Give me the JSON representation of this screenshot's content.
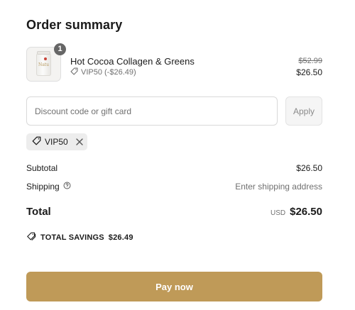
{
  "summary": {
    "title": "Order summary"
  },
  "product": {
    "quantity": "1",
    "name": "Hot Cocoa Collagen & Greens",
    "discount_label": "VIP50 (-$26.49)",
    "original_price": "$52.99",
    "price": "$26.50",
    "thumbnail_icon": "product-jar-icon"
  },
  "discount": {
    "placeholder": "Discount code or gift card",
    "value": "",
    "apply_label": "Apply",
    "applied_code": "VIP50"
  },
  "totals": {
    "subtotal_label": "Subtotal",
    "subtotal_value": "$26.50",
    "shipping_label": "Shipping",
    "shipping_value": "Enter shipping address",
    "total_label": "Total",
    "currency": "USD",
    "total_value": "$26.50"
  },
  "savings": {
    "label": "TOTAL SAVINGS",
    "value": "$26.49"
  },
  "pay": {
    "label": "Pay now"
  },
  "colors": {
    "accent": "#bf9a58",
    "badge": "#666666",
    "muted_text": "#707070",
    "chip_bg": "#ededed"
  }
}
